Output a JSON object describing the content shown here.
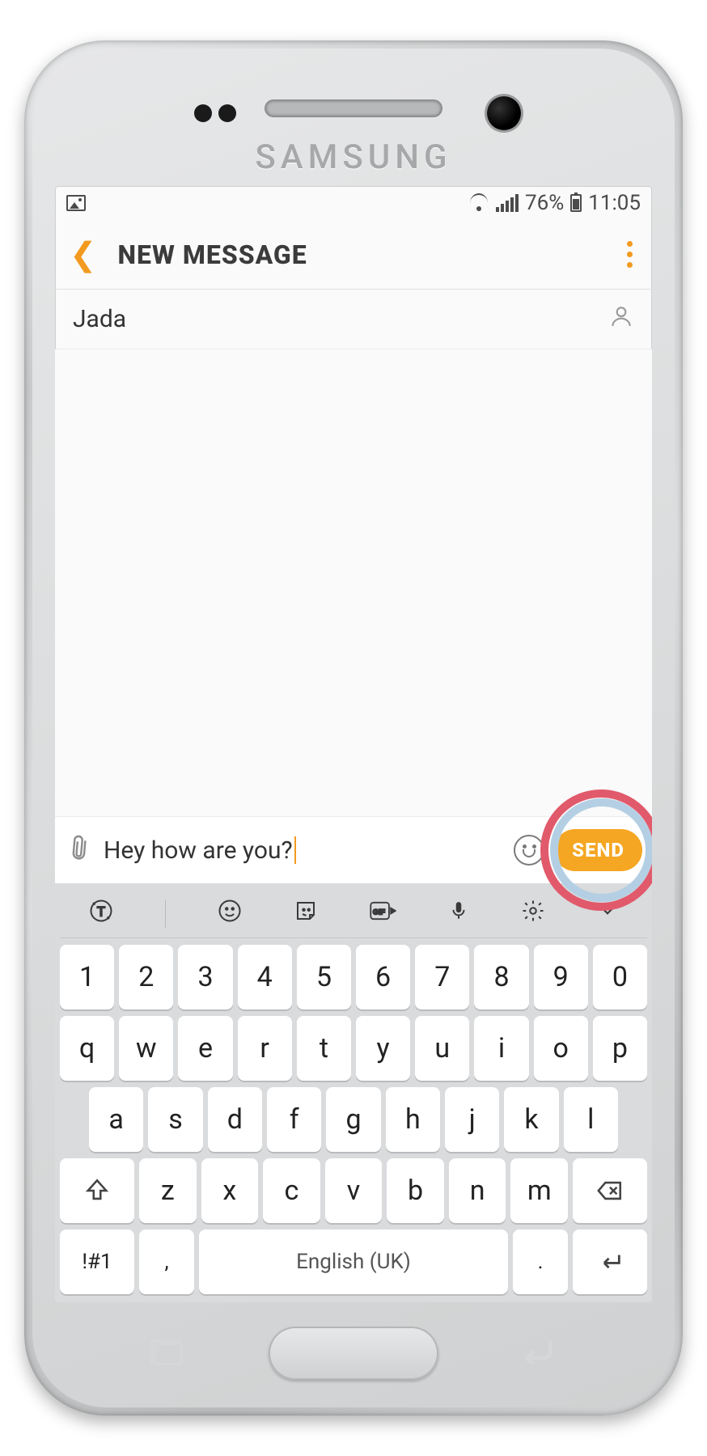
{
  "statusbar": {
    "battery": "76%",
    "time": "11:05"
  },
  "header": {
    "title": "NEW MESSAGE"
  },
  "recipient": {
    "name": "Jada"
  },
  "compose": {
    "text": "Hey how are you?",
    "send": "SEND"
  },
  "keyboard": {
    "row_num": [
      "1",
      "2",
      "3",
      "4",
      "5",
      "6",
      "7",
      "8",
      "9",
      "0"
    ],
    "row_top": [
      "q",
      "w",
      "e",
      "r",
      "t",
      "y",
      "u",
      "i",
      "o",
      "p"
    ],
    "row_mid": [
      "a",
      "s",
      "d",
      "f",
      "g",
      "h",
      "j",
      "k",
      "l"
    ],
    "row_bot": [
      "z",
      "x",
      "c",
      "v",
      "b",
      "n",
      "m"
    ],
    "sym": "!#1",
    "comma": ",",
    "space": "English (UK)",
    "period": "."
  }
}
